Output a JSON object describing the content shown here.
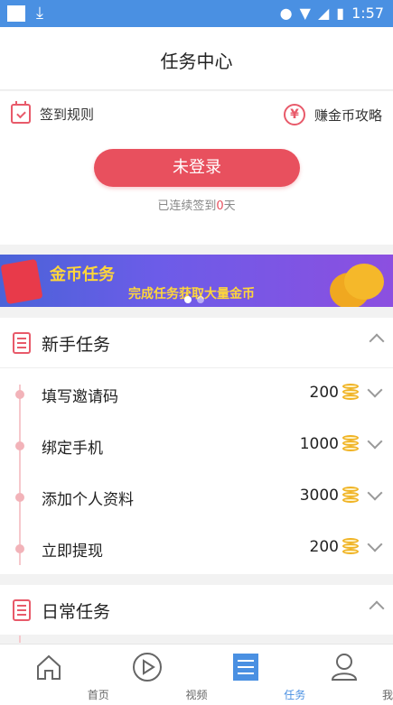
{
  "status_bar": {
    "time": "1:57"
  },
  "header": {
    "title": "任务中心"
  },
  "signin": {
    "rules_label": "签到规则",
    "tips_label": "赚金币攻略",
    "login_button": "未登录",
    "streak_prefix": "已连续签到",
    "streak_days": "0",
    "streak_suffix": "天"
  },
  "banner": {
    "title": "金币任务",
    "subtitle": "完成任务获取大量金币",
    "page_count": 2,
    "active_page": 1
  },
  "sections": {
    "newbie": {
      "title": "新手任务",
      "tasks": [
        {
          "name": "填写邀请码",
          "reward": "200"
        },
        {
          "name": "绑定手机",
          "reward": "1000"
        },
        {
          "name": "添加个人资料",
          "reward": "3000"
        },
        {
          "name": "立即提现",
          "reward": "200"
        }
      ]
    },
    "daily": {
      "title": "日常任务"
    }
  },
  "tabbar": {
    "items": [
      {
        "label": "首页",
        "icon": "home-icon",
        "active": false
      },
      {
        "label": "视频",
        "icon": "play-icon",
        "active": false
      },
      {
        "label": "任务",
        "icon": "task-list-icon",
        "active": true
      },
      {
        "label": "我的",
        "icon": "profile-icon",
        "active": false
      }
    ]
  },
  "colors": {
    "accent": "#e8505e",
    "tab_active": "#4a90e2",
    "coin": "#f0b323"
  }
}
